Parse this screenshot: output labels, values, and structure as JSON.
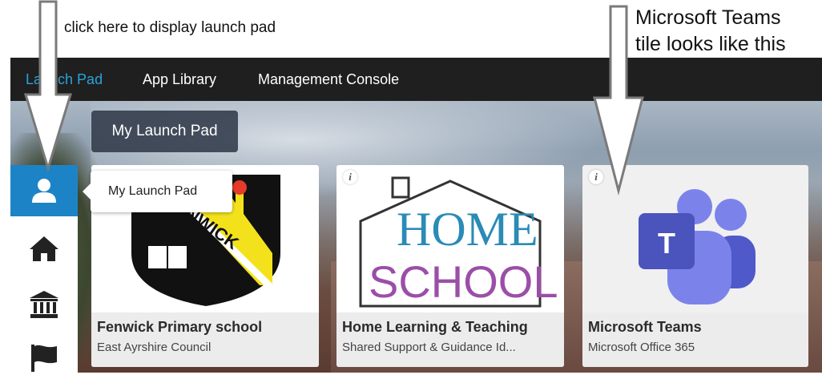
{
  "annotations": {
    "left_note": "click here to display launch pad",
    "right_note_line1": "Microsoft Teams",
    "right_note_line2": "tile looks like this"
  },
  "nav": {
    "items": [
      {
        "label": "Launch Pad",
        "active": true
      },
      {
        "label": "App Library",
        "active": false
      },
      {
        "label": "Management Console",
        "active": false
      }
    ]
  },
  "section": {
    "label": "My Launch Pad"
  },
  "tooltip": {
    "text": "My Launch Pad"
  },
  "sidebar": {
    "items": [
      {
        "icon": "user-icon",
        "active": true
      },
      {
        "icon": "home-icon",
        "active": false
      },
      {
        "icon": "institution-icon",
        "active": false
      },
      {
        "icon": "flag-icon",
        "active": false
      }
    ]
  },
  "tiles": [
    {
      "title": "Fenwick Primary school",
      "subtitle": "East Ayrshire Council",
      "logo_text": "NWICK",
      "logo_text_2": "K"
    },
    {
      "title": "Home Learning & Teaching",
      "subtitle": "Shared Support & Guidance Id...",
      "logo_text_home": "HOME",
      "logo_text_school": "SCHOOL"
    },
    {
      "title": "Microsoft Teams",
      "subtitle": "Microsoft Office 365",
      "logo_letter": "T"
    }
  ],
  "colors": {
    "nav_active": "#29a3db",
    "sidebar_active": "#1c84c6",
    "teams_purple": "#5059c9"
  }
}
